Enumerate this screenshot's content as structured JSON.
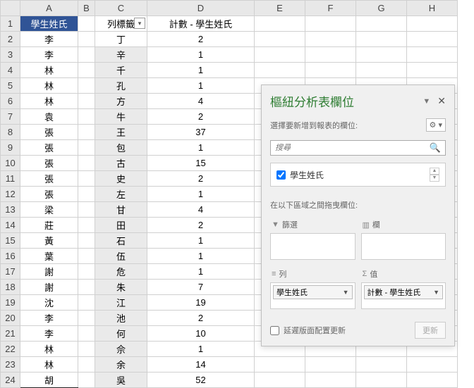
{
  "columns": [
    "A",
    "B",
    "C",
    "D",
    "E",
    "F",
    "G",
    "H"
  ],
  "header": {
    "colA": "學生姓氏",
    "colC": "列標籤",
    "colD": "計數 - 學生姓氏"
  },
  "rows": [
    {
      "n": 2,
      "a": "李",
      "c": "丁",
      "d": 2
    },
    {
      "n": 3,
      "a": "李",
      "c": "辛",
      "d": 1
    },
    {
      "n": 4,
      "a": "林",
      "c": "千",
      "d": 1
    },
    {
      "n": 5,
      "a": "林",
      "c": "孔",
      "d": 1
    },
    {
      "n": 6,
      "a": "林",
      "c": "方",
      "d": 4
    },
    {
      "n": 7,
      "a": "袁",
      "c": "牛",
      "d": 2
    },
    {
      "n": 8,
      "a": "張",
      "c": "王",
      "d": 37
    },
    {
      "n": 9,
      "a": "張",
      "c": "包",
      "d": 1
    },
    {
      "n": 10,
      "a": "張",
      "c": "古",
      "d": 15
    },
    {
      "n": 11,
      "a": "張",
      "c": "史",
      "d": 2
    },
    {
      "n": 12,
      "a": "張",
      "c": "左",
      "d": 1
    },
    {
      "n": 13,
      "a": "梁",
      "c": "甘",
      "d": 4
    },
    {
      "n": 14,
      "a": "莊",
      "c": "田",
      "d": 2
    },
    {
      "n": 15,
      "a": "黃",
      "c": "石",
      "d": 1
    },
    {
      "n": 16,
      "a": "葉",
      "c": "伍",
      "d": 1
    },
    {
      "n": 17,
      "a": "謝",
      "c": "危",
      "d": 1
    },
    {
      "n": 18,
      "a": "謝",
      "c": "朱",
      "d": 7
    },
    {
      "n": 19,
      "a": "沈",
      "c": "江",
      "d": 19
    },
    {
      "n": 20,
      "a": "李",
      "c": "池",
      "d": 2
    },
    {
      "n": 21,
      "a": "李",
      "c": "何",
      "d": 10
    },
    {
      "n": 22,
      "a": "林",
      "c": "佘",
      "d": 1
    },
    {
      "n": 23,
      "a": "林",
      "c": "余",
      "d": 14
    },
    {
      "n": 24,
      "a": "胡",
      "c": "吳",
      "d": 52
    }
  ],
  "panel": {
    "title": "樞紐分析表欄位",
    "subtitle": "選擇要新增到報表的欄位:",
    "search_placeholder": "搜尋",
    "field_name": "學生姓氏",
    "drag_label": "在以下區域之間拖曳欄位:",
    "area_filter": "篩選",
    "area_columns": "欄",
    "area_rows": "列",
    "area_values": "值",
    "chip_rows": "學生姓氏",
    "chip_values": "計數 - 學生姓氏",
    "defer_label": "延遲版面配置更新",
    "update_btn": "更新"
  }
}
